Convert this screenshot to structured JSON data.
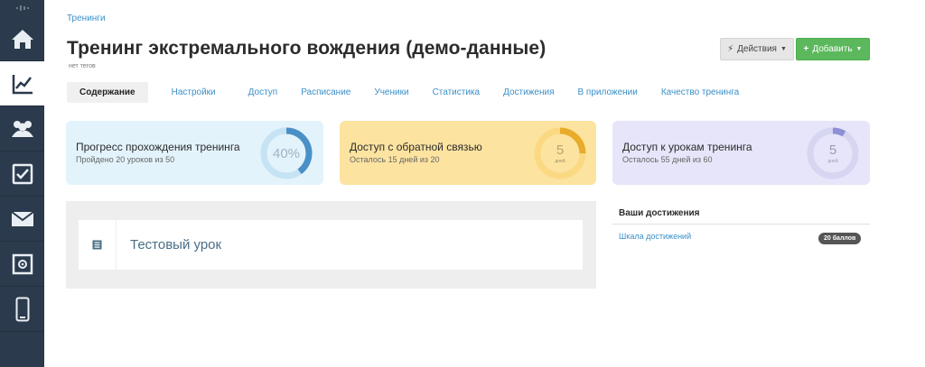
{
  "breadcrumb": "Тренинги",
  "page_title": "Тренинг экстремального вождения (демо-данные)",
  "tags_text": "нет тегов",
  "buttons": {
    "actions": "Действия",
    "add": "Добавить"
  },
  "tabs": [
    {
      "label": "Содержание",
      "active": true
    },
    {
      "label": "Настройки"
    },
    {
      "label": "Доступ"
    },
    {
      "label": "Расписание"
    },
    {
      "label": "Ученики"
    },
    {
      "label": "Статистика"
    },
    {
      "label": "Достижения"
    },
    {
      "label": "В приложении"
    },
    {
      "label": "Качество тренинга"
    }
  ],
  "cards": [
    {
      "title": "Прогресс прохождения тренинга",
      "subtitle": "Пройдено 20 уроков из 50",
      "ring_value": "40%",
      "ring_unit": "",
      "progress": 0.4,
      "color": "#4a90c7",
      "track": "#c6e3f3"
    },
    {
      "title": "Доступ с обратной связью",
      "subtitle": "Осталось 15 дней из 20",
      "ring_value": "5",
      "ring_unit": "дней",
      "progress": 0.25,
      "color": "#e8ac2a",
      "track": "#fbd983"
    },
    {
      "title": "Доступ к урокам тренинга",
      "subtitle": "Осталось 55 дней из 60",
      "ring_value": "5",
      "ring_unit": "дней",
      "progress": 0.083,
      "color": "#8e8fd6",
      "track": "#d6d5f2"
    }
  ],
  "lessons": [
    {
      "title": "Тестовый урок"
    }
  ],
  "achievements": {
    "title": "Ваши достижения",
    "items": [
      {
        "label": "Шкала достижений",
        "badge": "20 баллов"
      }
    ]
  },
  "sidebar": {
    "items": [
      {
        "icon": "home-icon"
      },
      {
        "icon": "chart-icon",
        "active": true
      },
      {
        "icon": "users-icon"
      },
      {
        "icon": "checkbox-icon"
      },
      {
        "icon": "mail-icon"
      },
      {
        "icon": "safe-icon"
      },
      {
        "icon": "mobile-icon"
      }
    ]
  }
}
